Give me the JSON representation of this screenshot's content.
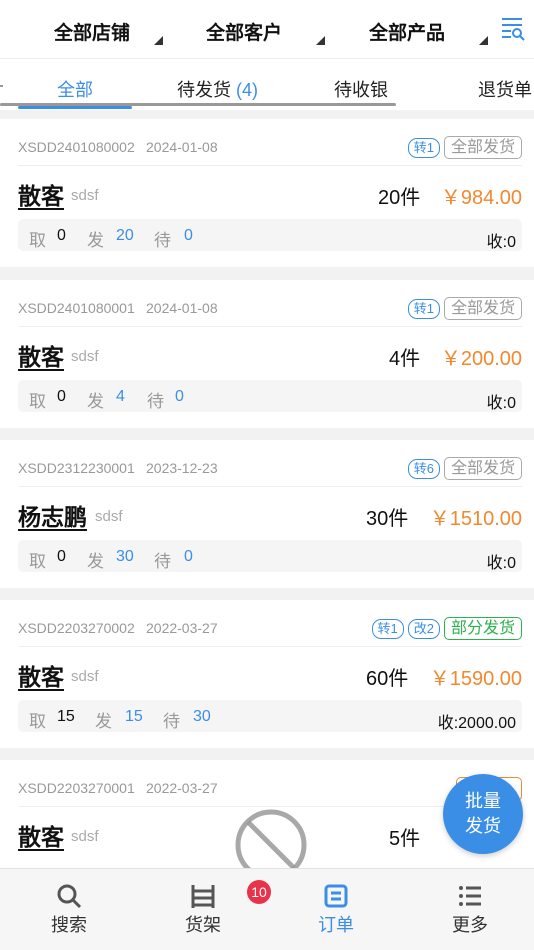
{
  "filters": [
    {
      "label": "全部店铺"
    },
    {
      "label": "全部客户"
    },
    {
      "label": "全部产品"
    }
  ],
  "filter_icon": "filter-list-icon",
  "tabs": [
    {
      "label": "全部",
      "count": ""
    },
    {
      "label": "待发货",
      "count": "(4)"
    },
    {
      "label": "待收银",
      "count": ""
    },
    {
      "label": "退货单",
      "count": ""
    }
  ],
  "stat_labels": {
    "take": "取",
    "sent": "发",
    "pending": "待"
  },
  "orders": [
    {
      "order_no": "XSDD2401080002",
      "date": "2024-01-08",
      "tags": [
        "转1"
      ],
      "status": "全部发货",
      "customer": "散客",
      "sub": "sdsf",
      "qty": "20件",
      "price": "￥984.00",
      "take": "0",
      "sent": "20",
      "pending": "0",
      "collected": "收:0"
    },
    {
      "order_no": "XSDD2401080001",
      "date": "2024-01-08",
      "tags": [
        "转1"
      ],
      "status": "全部发货",
      "customer": "散客",
      "sub": "sdsf",
      "qty": "4件",
      "price": "￥200.00",
      "take": "0",
      "sent": "4",
      "pending": "0",
      "collected": "收:0"
    },
    {
      "order_no": "XSDD2312230001",
      "date": "2023-12-23",
      "tags": [
        "转6"
      ],
      "status": "全部发货",
      "customer": "杨志鹏",
      "sub": "sdsf",
      "qty": "30件",
      "price": "￥1510.00",
      "take": "0",
      "sent": "30",
      "pending": "0",
      "collected": "收:0"
    },
    {
      "order_no": "XSDD2203270002",
      "date": "2022-03-27",
      "tags": [
        "转1",
        "改2"
      ],
      "status": "部分发货",
      "customer": "散客",
      "sub": "sdsf",
      "qty": "60件",
      "price": "￥1590.00",
      "take": "15",
      "sent": "15",
      "pending": "30",
      "collected": "收:2000.00"
    },
    {
      "order_no": "XSDD2203270001",
      "date": "2022-03-27",
      "customer": "散客",
      "sub": "sdsf",
      "qty": "5件"
    }
  ],
  "batch_button": {
    "line1": "批量",
    "line2": "发货"
  },
  "nav": [
    {
      "label": "搜索",
      "icon": "search-icon"
    },
    {
      "label": "货架",
      "icon": "shelf-icon",
      "badge": "10"
    },
    {
      "label": "订单",
      "icon": "order-icon"
    },
    {
      "label": "更多",
      "icon": "more-list-icon"
    }
  ],
  "colors": {
    "accent": "#3a8ee6",
    "price": "#f0892f",
    "partial": "#2bb24c",
    "badge": "#e8334a"
  }
}
